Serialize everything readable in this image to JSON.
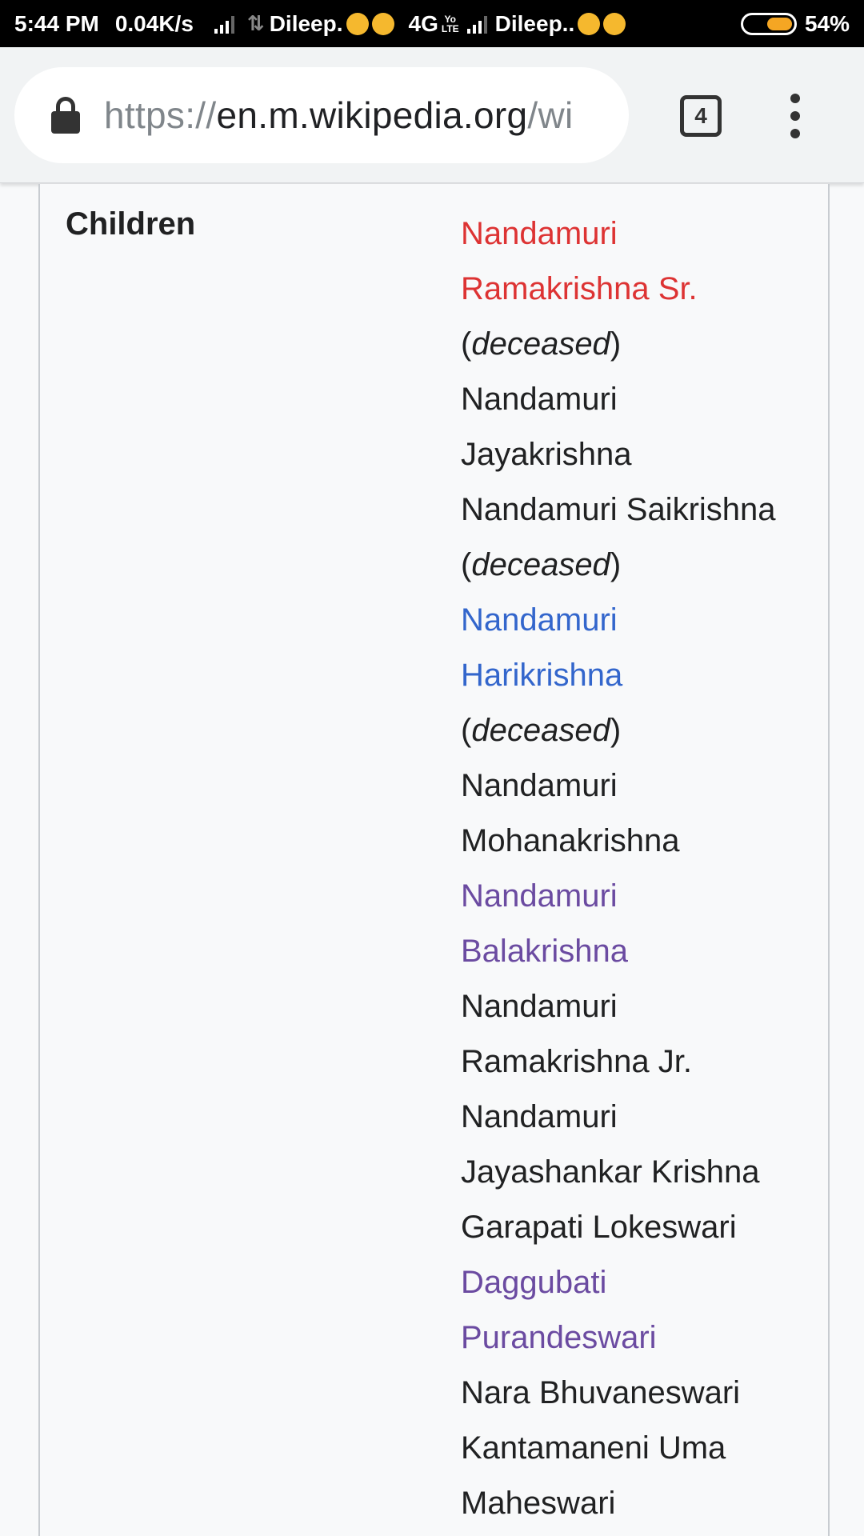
{
  "status_bar": {
    "time": "5:44 PM",
    "speed": "0.04K/s",
    "carrier1": "Dileep.",
    "network": "4G",
    "volte_top": "Yo",
    "volte_bottom": "LTE",
    "carrier2": "Dileep..",
    "battery": "54%",
    "battery_level": 0.54
  },
  "browser": {
    "url_scheme": "https://",
    "url_host": "en.m.wikipedia.org",
    "url_path": "/wi",
    "tab_count": "4"
  },
  "infobox": {
    "label": "Children",
    "lines": [
      {
        "text": "Nandamuri",
        "style": "red"
      },
      {
        "text": "Ramakrishna Sr.",
        "style": "red"
      },
      {
        "pre": "(",
        "italic": "deceased",
        "post": ")"
      },
      {
        "text": "Nandamuri",
        "style": "plain"
      },
      {
        "text": "Jayakrishna",
        "style": "plain"
      },
      {
        "text": "Nandamuri Saikrishna",
        "style": "plain"
      },
      {
        "pre": "(",
        "italic": "deceased",
        "post": ")"
      },
      {
        "text": "Nandamuri",
        "style": "blue"
      },
      {
        "text": "Harikrishna",
        "style": "blue"
      },
      {
        "pre": "(",
        "italic": "deceased",
        "post": ")"
      },
      {
        "text": "Nandamuri",
        "style": "plain"
      },
      {
        "text": "Mohanakrishna",
        "style": "plain"
      },
      {
        "text": "Nandamuri",
        "style": "purple"
      },
      {
        "text": "Balakrishna",
        "style": "purple"
      },
      {
        "text": "Nandamuri",
        "style": "plain"
      },
      {
        "text": "Ramakrishna Jr.",
        "style": "plain"
      },
      {
        "text": "Nandamuri",
        "style": "plain"
      },
      {
        "text": "Jayashankar Krishna",
        "style": "plain"
      },
      {
        "text": "Garapati Lokeswari",
        "style": "plain"
      },
      {
        "text": "Daggubati",
        "style": "purple"
      },
      {
        "text": "Purandeswari",
        "style": "purple"
      },
      {
        "text": "Nara Bhuvaneswari",
        "style": "plain"
      },
      {
        "text": "Kantamaneni Uma",
        "style": "plain"
      },
      {
        "text": "Maheswari",
        "style": "plain"
      }
    ]
  }
}
